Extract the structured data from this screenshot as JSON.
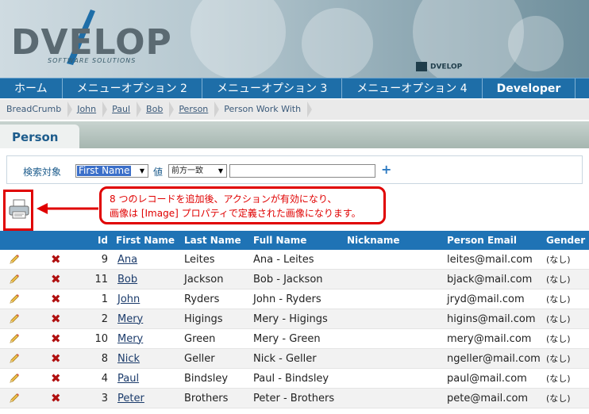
{
  "header": {
    "logo_text": "DVELOP",
    "logo_sub": "SOFTWARE SOLUTIONS",
    "small_logo": "DVELOP"
  },
  "nav": {
    "items": [
      {
        "label": "ホーム"
      },
      {
        "label": "メニューオプション 2"
      },
      {
        "label": "メニューオプション 3"
      },
      {
        "label": "メニューオプション 4"
      },
      {
        "label": "Developer"
      }
    ]
  },
  "breadcrumb": {
    "items": [
      {
        "label": "BreadCrumb"
      },
      {
        "label": "John"
      },
      {
        "label": "Paul"
      },
      {
        "label": "Bob"
      },
      {
        "label": "Person"
      },
      {
        "label": "Person Work With"
      }
    ]
  },
  "page": {
    "title": "Person"
  },
  "search": {
    "label": "検索対象",
    "field_value": "First Name",
    "value_label": "値",
    "operator_value": "前方一致",
    "text_value": "",
    "add_symbol": "+"
  },
  "callout": {
    "line1": "8 つのレコードを追加後、アクションが有効になり、",
    "line2": "画像は [Image] プロパティで定義された画像になります。"
  },
  "grid": {
    "columns": {
      "id": "Id",
      "first": "First Name",
      "last": "Last Name",
      "full": "Full Name",
      "nick": "Nickname",
      "email": "Person Email",
      "gender": "Gender"
    },
    "rows": [
      {
        "id": "9",
        "first": "Ana",
        "last": "Leites",
        "full": "Ana - Leites",
        "nick": "",
        "email": "leites@mail.com",
        "gender": "(なし)"
      },
      {
        "id": "11",
        "first": "Bob",
        "last": "Jackson",
        "full": "Bob - Jackson",
        "nick": "",
        "email": "bjack@mail.com",
        "gender": "(なし)"
      },
      {
        "id": "1",
        "first": "John",
        "last": "Ryders",
        "full": "John - Ryders",
        "nick": "",
        "email": "jryd@mail.com",
        "gender": "(なし)"
      },
      {
        "id": "2",
        "first": "Mery",
        "last": "Higings",
        "full": "Mery - Higings",
        "nick": "",
        "email": "higins@mail.com",
        "gender": "(なし)"
      },
      {
        "id": "10",
        "first": "Mery",
        "last": "Green",
        "full": "Mery - Green",
        "nick": "",
        "email": "mery@mail.com",
        "gender": "(なし)"
      },
      {
        "id": "8",
        "first": "Nick",
        "last": "Geller",
        "full": "Nick - Geller",
        "nick": "",
        "email": "ngeller@mail.com",
        "gender": "(なし)"
      },
      {
        "id": "4",
        "first": "Paul",
        "last": "Bindsley",
        "full": "Paul - Bindsley",
        "nick": "",
        "email": "paul@mail.com",
        "gender": "(なし)"
      },
      {
        "id": "3",
        "first": "Peter",
        "last": "Brothers",
        "full": "Peter - Brothers",
        "nick": "",
        "email": "pete@mail.com",
        "gender": "(なし)"
      }
    ]
  },
  "colors": {
    "nav": "#1e6ea8",
    "grid_header": "#1f73b5",
    "callout": "#e00000"
  }
}
